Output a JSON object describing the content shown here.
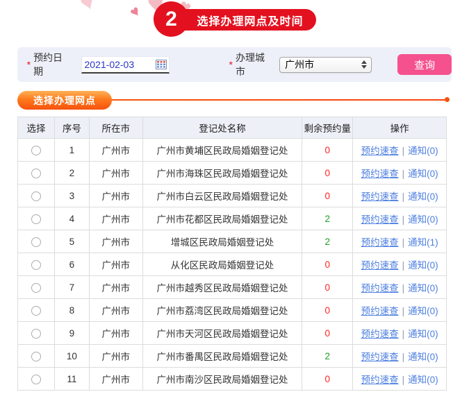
{
  "step_banner": {
    "number": "2",
    "title": "选择办理网点及时间"
  },
  "filters": {
    "required_mark": "*",
    "date_label": "预约日期",
    "date_value": "2021-02-03",
    "city_label": "办理城市",
    "city_selected": "广州市",
    "query_button_label": "查询"
  },
  "section": {
    "title": "选择办理网点"
  },
  "table": {
    "headers": [
      "选择",
      "序号",
      "所在市",
      "登记处名称",
      "剩余预约量",
      "操作"
    ],
    "link_check_label": "预约速查",
    "link_separator": "|",
    "rows": [
      {
        "no": "1",
        "city": "广州市",
        "office": "广州市黄埔区民政局婚姻登记处",
        "remaining": "0",
        "remaining_status": "none",
        "notice_label": "通知(0)"
      },
      {
        "no": "2",
        "city": "广州市",
        "office": "广州市海珠区民政局婚姻登记处",
        "remaining": "0",
        "remaining_status": "none",
        "notice_label": "通知(0)"
      },
      {
        "no": "3",
        "city": "广州市",
        "office": "广州市白云区民政局婚姻登记处",
        "remaining": "0",
        "remaining_status": "none",
        "notice_label": "通知(0)"
      },
      {
        "no": "4",
        "city": "广州市",
        "office": "广州市花都区民政局婚姻登记处",
        "remaining": "2",
        "remaining_status": "available",
        "notice_label": "通知(0)"
      },
      {
        "no": "5",
        "city": "广州市",
        "office": "增城区民政局婚姻登记处",
        "remaining": "2",
        "remaining_status": "available",
        "notice_label": "通知(1)"
      },
      {
        "no": "6",
        "city": "广州市",
        "office": "从化区民政局婚姻登记处",
        "remaining": "0",
        "remaining_status": "none",
        "notice_label": "通知(0)"
      },
      {
        "no": "7",
        "city": "广州市",
        "office": "广州市越秀区民政局婚姻登记处",
        "remaining": "0",
        "remaining_status": "none",
        "notice_label": "通知(0)"
      },
      {
        "no": "8",
        "city": "广州市",
        "office": "广州市荔湾区民政局婚姻登记处",
        "remaining": "0",
        "remaining_status": "none",
        "notice_label": "通知(0)"
      },
      {
        "no": "9",
        "city": "广州市",
        "office": "广州市天河区民政局婚姻登记处",
        "remaining": "0",
        "remaining_status": "none",
        "notice_label": "通知(0)"
      },
      {
        "no": "10",
        "city": "广州市",
        "office": "广州市番禺区民政局婚姻登记处",
        "remaining": "2",
        "remaining_status": "available",
        "notice_label": "通知(0)"
      },
      {
        "no": "11",
        "city": "广州市",
        "office": "广州市南沙区民政局婚姻登记处",
        "remaining": "0",
        "remaining_status": "none",
        "notice_label": "通知(0)"
      }
    ]
  },
  "icons": {
    "calendar": "calendar-icon",
    "select_stepper": "up-down-arrows-icon",
    "hearts_decoration": "heart-icon"
  },
  "colors": {
    "banner_red": "#e3111f",
    "button_pink": "#f5518f",
    "section_orange_start": "#ffb257",
    "section_orange_end": "#f6520d",
    "filter_bar_bg": "#edf0f8",
    "table_header_bg": "#eef0f8",
    "link_blue": "#4d7fe0",
    "remaining_zero": "#ff2222",
    "remaining_available": "#1f9d2a",
    "date_text_blue": "#2a35c8"
  }
}
